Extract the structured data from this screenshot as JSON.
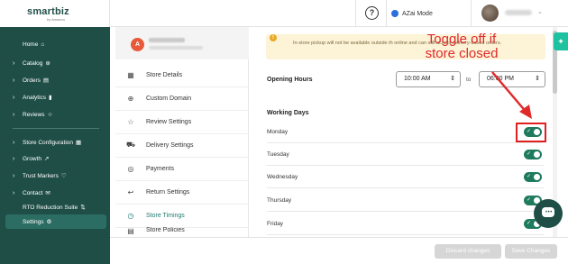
{
  "brand": {
    "logo": "smartbiz",
    "tagline": "by Amazon"
  },
  "topbar": {
    "help_symbol": "?",
    "azai_label": "AZai Mode"
  },
  "sidebar": {
    "items": [
      {
        "label": "Home",
        "icon": "⌂",
        "chev": ""
      },
      {
        "label": "Catalog",
        "icon": "⊛",
        "chev": "›"
      },
      {
        "label": "Orders",
        "icon": "▤",
        "chev": "›"
      },
      {
        "label": "Analytics",
        "icon": "▮",
        "chev": "›"
      },
      {
        "label": "Reviews",
        "icon": "☆",
        "chev": "›"
      },
      {
        "label": "Store Configuration",
        "icon": "▦",
        "chev": "›"
      },
      {
        "label": "Growth",
        "icon": "↗",
        "chev": "›"
      },
      {
        "label": "Trust Markers",
        "icon": "♡",
        "chev": "›"
      },
      {
        "label": "Contact",
        "icon": "✉",
        "chev": "›"
      },
      {
        "label": "RTO Reduction Suite",
        "icon": "⇅",
        "chev": ""
      },
      {
        "label": "Settings",
        "icon": "⚙",
        "chev": ""
      }
    ]
  },
  "store": {
    "avatar_letter": "A"
  },
  "settings_menu": [
    {
      "label": "Store Details",
      "icon": "▦"
    },
    {
      "label": "Custom Domain",
      "icon": "⊕"
    },
    {
      "label": "Review Settings",
      "icon": "☆"
    },
    {
      "label": "Delivery Settings",
      "icon": "⛟"
    },
    {
      "label": "Payments",
      "icon": "◎"
    },
    {
      "label": "Return Settings",
      "icon": "↩"
    },
    {
      "label": "Store Timings",
      "icon": "◷"
    },
    {
      "label": "Store Policies",
      "icon": "▤"
    }
  ],
  "notice": {
    "icon": "!",
    "text": "In-store pickup will not be available outside th                          online and can still accept delivery-based orders."
  },
  "opening_hours": {
    "label": "Opening Hours",
    "from": "10:00 AM",
    "to_label": "to",
    "to": "06:00 PM"
  },
  "working_days": {
    "title": "Working Days",
    "days": [
      {
        "name": "Monday",
        "on": true
      },
      {
        "name": "Tuesday",
        "on": true
      },
      {
        "name": "Wednesday",
        "on": true
      },
      {
        "name": "Thursday",
        "on": true
      },
      {
        "name": "Friday",
        "on": true
      }
    ]
  },
  "annotation": {
    "line1": "Toggle off if",
    "line2": "store closed"
  },
  "footer": {
    "discard_label": "Discard changes",
    "save_label": "Save Changes"
  },
  "colors": {
    "sidebar": "#1f4e47",
    "accent": "#1f7a5e",
    "annotation": "#e02a2a"
  }
}
